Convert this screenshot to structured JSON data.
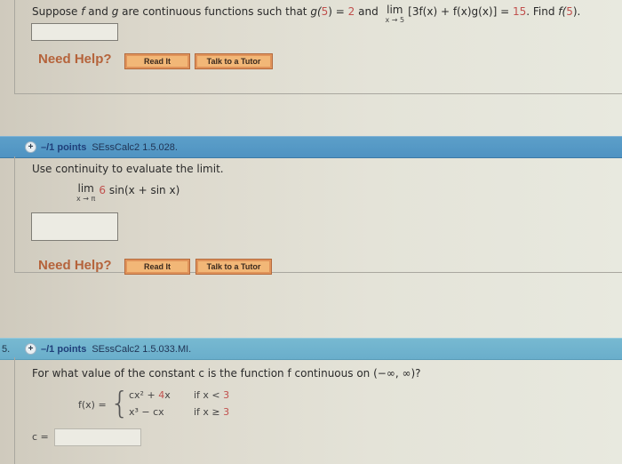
{
  "question1": {
    "prompt_parts": {
      "intro": "Suppose ",
      "f": "f",
      "and": " and ",
      "g": "g",
      "mid": " are continuous functions such that ",
      "g5": "g(",
      "five": "5",
      "close": ") = ",
      "val2": "2",
      "and2": " and ",
      "lim": "lim",
      "lim_sub": "x → 5",
      "expr": "[3f(x) + f(x)g(x)] = ",
      "val15": "15",
      "find": ". Find ",
      "f5": "f(",
      "five2": "5",
      "end": ")."
    },
    "answer_value": "",
    "need_help": "Need Help?",
    "read_it": "Read It",
    "talk_tutor": "Talk to a Tutor"
  },
  "question2": {
    "number": "",
    "points": "–/1 points",
    "reference": "SEssCalc2 1.5.028.",
    "prompt": "Use continuity to evaluate the limit.",
    "lim": "lim",
    "lim_sub": "x → π",
    "coef": "6",
    "expr": "sin(x + sin x)",
    "answer_value": "",
    "need_help": "Need Help?",
    "read_it": "Read It",
    "talk_tutor": "Talk to a Tutor"
  },
  "question3": {
    "number": "5.",
    "points": "–/1 points",
    "reference": "SEssCalc2 1.5.033.MI.",
    "prompt": "For what value of the constant c is the function f continuous on (−∞, ∞)?",
    "fx_label": "f(x) =",
    "case1_expr_a": "cx² + ",
    "case1_expr_b": "4",
    "case1_expr_c": "x",
    "case1_cond": "if x < ",
    "case1_val": "3",
    "case2_expr": "x³ − cx",
    "case2_cond": "if x ≥ ",
    "case2_val": "3",
    "answer_label": "c =",
    "answer_value": ""
  },
  "icons": {
    "expand": "plus-circle-icon"
  }
}
